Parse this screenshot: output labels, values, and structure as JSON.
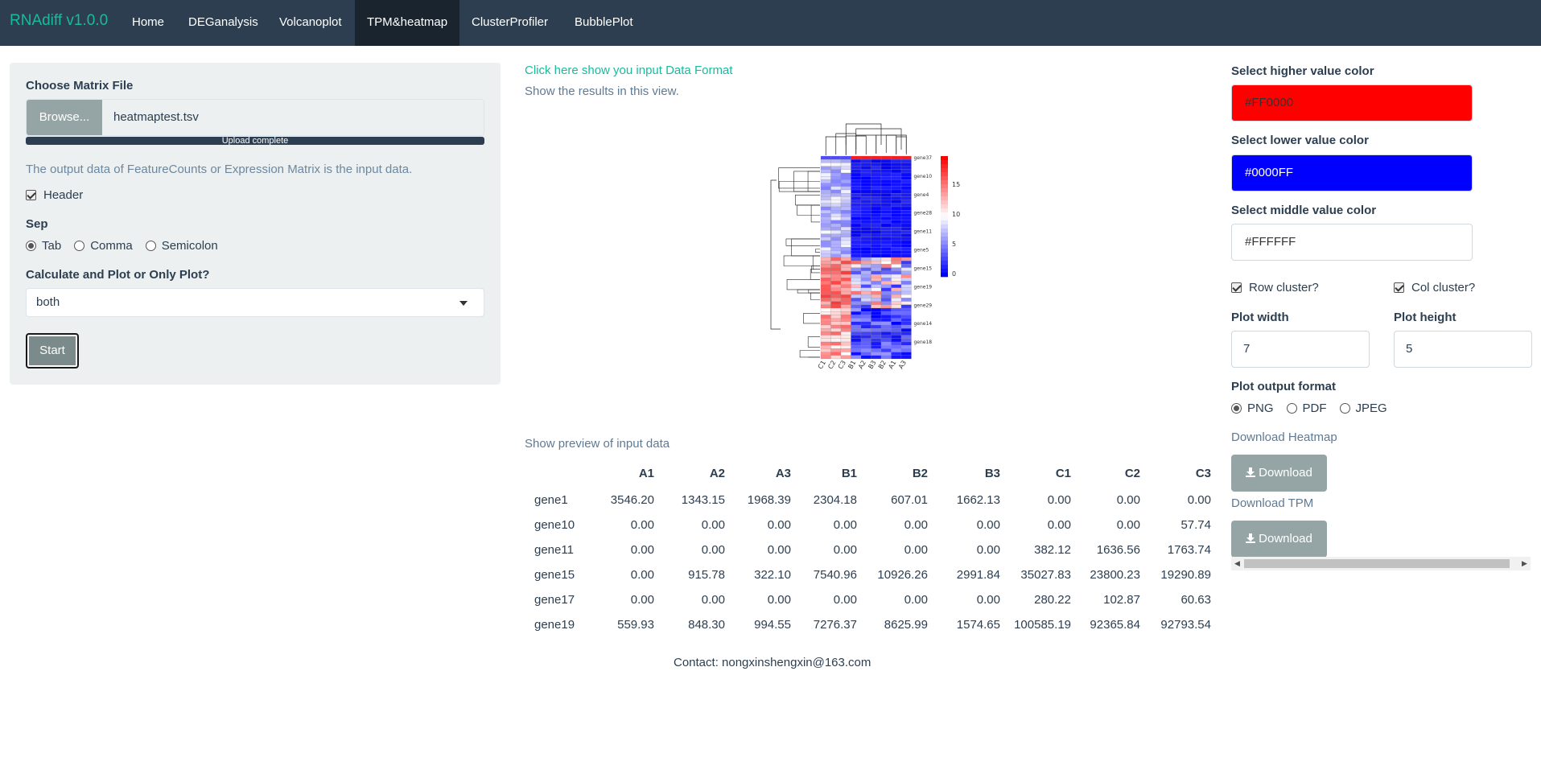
{
  "app": {
    "brand": "RNAdiff v1.0.0"
  },
  "nav": {
    "tabs": [
      {
        "label": "Home"
      },
      {
        "label": "DEGanalysis"
      },
      {
        "label": "Volcanoplot"
      },
      {
        "label": "TPM&heatmap",
        "active": true
      },
      {
        "label": "ClusterProfiler"
      },
      {
        "label": "BubblePlot"
      }
    ]
  },
  "sidebar": {
    "file_label": "Choose Matrix File",
    "browse_label": "Browse...",
    "file_name": "heatmaptest.tsv",
    "upload_status": "Upload complete",
    "upload_progress": 1.0,
    "note": "The output data of FeatureCounts or Expression Matrix is the input data.",
    "header_label": "Header",
    "header_checked": true,
    "sep_label": "Sep",
    "sep_options": [
      "Tab",
      "Comma",
      "Semicolon"
    ],
    "sep_selected": "Tab",
    "mode_label": "Calculate and Plot or Only Plot?",
    "mode_value": "both",
    "start_label": "Start"
  },
  "main": {
    "format_link": "Click here show you input Data Format",
    "results_link": "Show the results in this view.",
    "preview_link": "Show preview of input data",
    "columns": [
      "A1",
      "A2",
      "A3",
      "B1",
      "B2",
      "B3",
      "C1",
      "C2",
      "C3"
    ],
    "rows": [
      {
        "name": "gene1",
        "values": [
          "3546.20",
          "1343.15",
          "1968.39",
          "2304.18",
          "607.01",
          "1662.13",
          "0.00",
          "0.00",
          "0.00"
        ]
      },
      {
        "name": "gene10",
        "values": [
          "0.00",
          "0.00",
          "0.00",
          "0.00",
          "0.00",
          "0.00",
          "0.00",
          "0.00",
          "57.74"
        ]
      },
      {
        "name": "gene11",
        "values": [
          "0.00",
          "0.00",
          "0.00",
          "0.00",
          "0.00",
          "0.00",
          "382.12",
          "1636.56",
          "1763.74"
        ]
      },
      {
        "name": "gene15",
        "values": [
          "0.00",
          "915.78",
          "322.10",
          "7540.96",
          "10926.26",
          "2991.84",
          "35027.83",
          "23800.23",
          "19290.89"
        ]
      },
      {
        "name": "gene17",
        "values": [
          "0.00",
          "0.00",
          "0.00",
          "0.00",
          "0.00",
          "0.00",
          "280.22",
          "102.87",
          "60.63"
        ]
      },
      {
        "name": "gene19",
        "values": [
          "559.93",
          "848.30",
          "994.55",
          "7276.37",
          "8625.99",
          "1574.65",
          "100585.19",
          "92365.84",
          "92793.54"
        ]
      }
    ],
    "contact": "Contact: nongxinshengxin@163.com"
  },
  "heatmap": {
    "column_labels": [
      "C1",
      "C2",
      "C3",
      "B1",
      "A2",
      "B3",
      "B2",
      "A1",
      "A3"
    ],
    "legend_ticks": [
      "15",
      "10",
      "5",
      "0"
    ],
    "row_labels_visible": [
      "gene37",
      "gene10",
      "gene4",
      "gene28",
      "gene11",
      "gene5",
      "gene15",
      "gene19",
      "gene29",
      "gene14",
      "gene18"
    ],
    "colors": {
      "high": "#FF0000",
      "mid": "#FFFFFF",
      "low": "#0000FF"
    }
  },
  "right": {
    "higher_label": "Select higher value color",
    "higher_value": "#FF0000",
    "higher_bg": "#ff0000",
    "lower_label": "Select lower value color",
    "lower_value": "#0000FF",
    "lower_bg": "#0000ff",
    "middle_label": "Select middle value color",
    "middle_value": "#FFFFFF",
    "middle_bg": "#ffffff",
    "row_cluster_label": "Row cluster?",
    "row_cluster_checked": true,
    "col_cluster_label": "Col cluster?",
    "col_cluster_checked": true,
    "width_label": "Plot width",
    "width_value": "7",
    "height_label": "Plot height",
    "height_value": "5",
    "format_label": "Plot output format",
    "format_options": [
      "PNG",
      "PDF",
      "JPEG"
    ],
    "format_selected": "PNG",
    "download_heatmap_label": "Download Heatmap",
    "download_tpm_label": "Download TPM",
    "download_button_label": "Download"
  }
}
